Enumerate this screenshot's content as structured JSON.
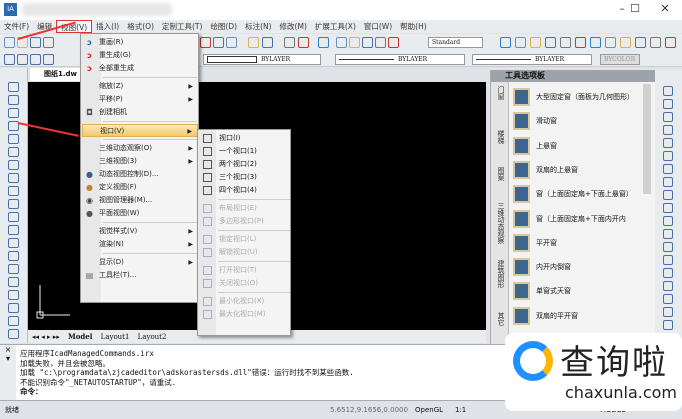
{
  "app": {
    "icon_text": "IA"
  },
  "window_controls": {
    "minimize": "–",
    "maximize": "☐",
    "close": "✕"
  },
  "menubar": [
    "文件(F)",
    "编辑",
    "视图(V)",
    "插入(I)",
    "格式(O)",
    "定制工具(T)",
    "绘图(D)",
    "标注(N)",
    "修改(M)",
    "扩展工具(X)",
    "窗口(W)",
    "帮助(H)"
  ],
  "toolbar": {
    "text_style": "Standard",
    "linetype1": "BYLAYER",
    "linetype2": "BYLAYER",
    "linetype3": "BYLAYER",
    "color": "BYCOLOR"
  },
  "document_tab": "图纸1.dw",
  "view_menu": {
    "items": [
      {
        "label": "重画(R)",
        "icon": "redraw-icon"
      },
      {
        "label": "重生成(G)",
        "icon": "regen-icon"
      },
      {
        "label": "全部重生成",
        "icon": "regen-all-icon"
      },
      {
        "label": "缩放(Z)",
        "submenu": true
      },
      {
        "label": "平移(P)",
        "submenu": true
      },
      {
        "label": "创建相机",
        "icon": "camera-icon"
      },
      {
        "label": "视口(V)",
        "submenu": true,
        "highlighted": true
      },
      {
        "label": "三维动态观察(O)",
        "submenu": true
      },
      {
        "label": "三维视图(3)",
        "submenu": true
      },
      {
        "label": "动态视图控制(D)...",
        "icon": "dynamic-view-icon"
      },
      {
        "label": "定义视图(F)",
        "icon": "define-view-icon"
      },
      {
        "label": "视图管理器(M)...",
        "icon": "view-manager-icon"
      },
      {
        "label": "平面视图(W)",
        "icon": "plan-view-icon"
      },
      {
        "label": "视觉样式(V)",
        "submenu": true
      },
      {
        "label": "渲染(N)",
        "submenu": true
      },
      {
        "label": "显示(D)",
        "submenu": true
      },
      {
        "label": "工具栏(T)...",
        "icon": "toolbar-icon"
      }
    ]
  },
  "viewport_submenu": {
    "items": [
      {
        "label": "视口(I)",
        "enabled": true
      },
      {
        "label": "一个视口(1)",
        "enabled": true
      },
      {
        "label": "两个视口(2)",
        "enabled": true
      },
      {
        "label": "三个视口(3)",
        "enabled": true
      },
      {
        "label": "四个视口(4)",
        "enabled": true
      },
      {
        "label": "布局视口(E)",
        "enabled": false
      },
      {
        "label": "多边形视口(P)",
        "enabled": false
      },
      {
        "label": "锁定视口(L)",
        "enabled": false
      },
      {
        "label": "解锁视口(U)",
        "enabled": false
      },
      {
        "label": "打开视口(T)",
        "enabled": false
      },
      {
        "label": "关闭视口(O)",
        "enabled": false
      },
      {
        "label": "最小化视口(X)",
        "enabled": false
      },
      {
        "label": "最大化视口(M)",
        "enabled": false
      }
    ]
  },
  "layout_tabs": [
    "Model",
    "Layout1",
    "Layout2"
  ],
  "tool_palette": {
    "title": "工具选项板",
    "vertical_tabs": [
      "门窗",
      "楼梯",
      "图案",
      "三维动态观察",
      "建筑图形",
      "其它"
    ],
    "items": [
      "大型固定窗（面板为几何图形）",
      "滑动窗",
      "上悬窗",
      "双扇的上悬窗",
      "窗（上面固定扇+下面上悬窗）",
      "窗（上面固定扇+下面内开内",
      "平开窗",
      "内开内倒窗",
      "单窗式天窗",
      "双扇的平开窗"
    ]
  },
  "command_lines": [
    "应用程序IcadManagedCommands.irx",
    "加载失败，并且会被忽略。",
    "加载 \"c:\\programdata\\zjcadeditor\\adskorastersds.dll\"错误：运行时找不到某些函数.",
    "不能识别命令\"_NETAUTOSTARTUP\"，请重试.",
    "命令："
  ],
  "status": {
    "left": "就绪",
    "coords": "5.6512,9.1656,0.0000",
    "renderer": "OpenGL",
    "scale": "1:1",
    "mode": "MODEL"
  },
  "watermark": {
    "text": "查询啦",
    "domain": "chaxunla.com"
  }
}
